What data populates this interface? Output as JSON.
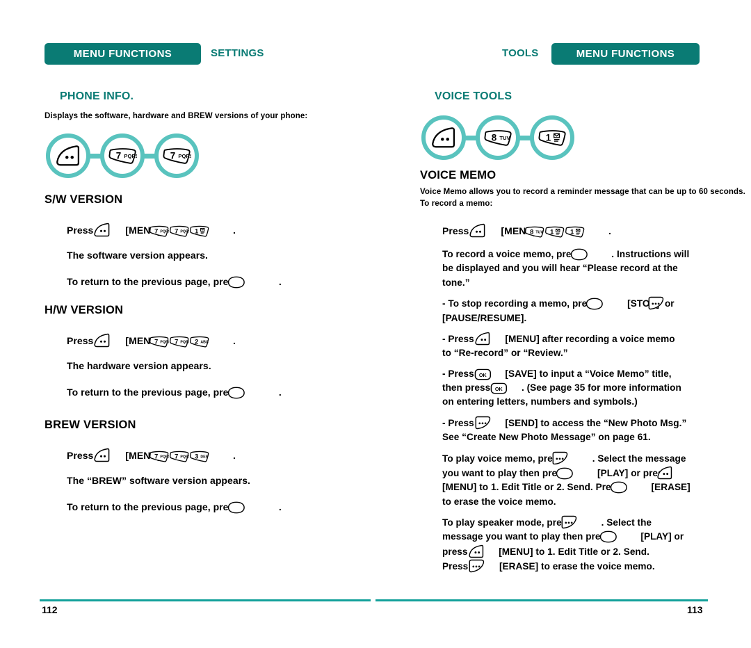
{
  "colors": {
    "band_teal": "#0a7b74",
    "circle_teal": "#59c3be",
    "rule_teal": "#12a09a"
  },
  "left_page": {
    "header": {
      "band_label": "MENU FUNCTIONS",
      "sub_label": "SETTINGS"
    },
    "section_title": "PHONE INFO.",
    "intro": "Displays the software, hardware and BREW versions of your phone:",
    "key_sequence": [
      {
        "icon": "menu-key-icon",
        "label": ""
      },
      {
        "icon": "number-key-icon",
        "digit": "7",
        "letters": "PQRS"
      },
      {
        "icon": "number-key-icon",
        "digit": "7",
        "letters": "PQRS"
      }
    ],
    "blocks": [
      {
        "heading": "S/W VERSION",
        "lines": [
          {
            "text_a": "Press",
            "key_a": "menu-key-icon",
            "text_b": "[MENU]",
            "keys": [
              {
                "digit": "7",
                "letters": "PQRS"
              },
              {
                "digit": "7",
                "letters": "PQRS"
              },
              {
                "digit": "1",
                "letters": "envelope"
              }
            ],
            "text_c": "."
          },
          {
            "text_a": "The software version appears."
          },
          {
            "text_a": "To return to the previous page, press",
            "key_end": "clear-key-icon",
            "text_c": "."
          }
        ]
      },
      {
        "heading": "H/W VERSION",
        "lines": [
          {
            "text_a": "Press",
            "key_a": "menu-key-icon",
            "text_b": "[MENU]",
            "keys": [
              {
                "digit": "7",
                "letters": "PQRS"
              },
              {
                "digit": "7",
                "letters": "PQRS"
              },
              {
                "digit": "2",
                "letters": "ABC"
              }
            ],
            "text_c": "."
          },
          {
            "text_a": "The hardware version appears."
          },
          {
            "text_a": "To return to the previous page, press",
            "key_end": "clear-key-icon",
            "text_c": "."
          }
        ]
      },
      {
        "heading": "BREW VERSION",
        "lines": [
          {
            "text_a": "Press",
            "key_a": "menu-key-icon",
            "text_b": "[MENU]",
            "keys": [
              {
                "digit": "7",
                "letters": "PQRS"
              },
              {
                "digit": "7",
                "letters": "PQRS"
              },
              {
                "digit": "3",
                "letters": "DEF"
              }
            ],
            "text_c": "."
          },
          {
            "text_a": "The “BREW” software version appears."
          },
          {
            "text_a": "To return to the previous page, press",
            "key_end": "clear-key-icon",
            "text_c": "."
          }
        ]
      }
    ],
    "folio": "112"
  },
  "right_page": {
    "header": {
      "band_label": "MENU FUNCTIONS",
      "sub_label": "TOOLS"
    },
    "section_title": "VOICE TOOLS",
    "key_sequence": [
      {
        "icon": "menu-key-icon",
        "label": ""
      },
      {
        "icon": "number-key-icon",
        "digit": "8",
        "letters": "TUV"
      },
      {
        "icon": "number-key-icon",
        "digit": "1",
        "letters": "envelope"
      }
    ],
    "subhead": "VOICE MEMO",
    "intro": "Voice Memo allows you to record a reminder message that can be up to 60 seconds. To record a memo:",
    "press_line": {
      "text_a": "Press",
      "key_a": "menu-key-icon",
      "text_b": "[MENU]",
      "keys": [
        {
          "digit": "8",
          "letters": "TUV"
        },
        {
          "digit": "1",
          "letters": "envelope"
        },
        {
          "digit": "1",
          "letters": "envelope"
        }
      ],
      "text_c": "."
    },
    "paragraphs": [
      {
        "id": "record-paragraph",
        "lines": [
          {
            "segments": [
              {
                "t": "To record a voice memo, press"
              },
              {
                "k": "clear-key-icon",
                "overlap": true
              },
              {
                "gap": "m"
              },
              {
                "t": ". Instructions will"
              }
            ]
          },
          {
            "segments": [
              {
                "t": "be displayed and you will hear “Please record at the"
              }
            ]
          },
          {
            "segments": [
              {
                "t": "tone.”"
              }
            ]
          }
        ]
      },
      {
        "id": "stop-recording-bullet",
        "bullet": true,
        "lines": [
          {
            "segments": [
              {
                "t": "- To stop recording a memo, press"
              },
              {
                "k": "clear-key-icon",
                "overlap": true
              },
              {
                "gap": "m"
              },
              {
                "t": "[STOP]"
              },
              {
                "k": "send-key-icon",
                "overlap": true
              },
              {
                "t": "or"
              }
            ]
          },
          {
            "segments": [
              {
                "t": "[PAUSE/RESUME]."
              }
            ]
          }
        ]
      },
      {
        "id": "menu-after-recording-bullet",
        "bullet": true,
        "lines": [
          {
            "segments": [
              {
                "t": "- Press"
              },
              {
                "k": "menu-key-icon"
              },
              {
                "gap": "s"
              },
              {
                "t": "[MENU] after recording a voice memo"
              }
            ]
          },
          {
            "segments": [
              {
                "t": "to “Re-record” or “Review.”"
              }
            ]
          }
        ]
      },
      {
        "id": "save-bullet",
        "bullet": true,
        "lines": [
          {
            "segments": [
              {
                "t": "- Press"
              },
              {
                "k": "ok-key-icon"
              },
              {
                "gap": "s"
              },
              {
                "t": "[SAVE] to input a “Voice Memo” title,"
              }
            ]
          },
          {
            "segments": [
              {
                "t": "then press"
              },
              {
                "k": "ok-key-icon"
              },
              {
                "gap": "s"
              },
              {
                "t": ". (See page 35 for more information"
              }
            ]
          },
          {
            "segments": [
              {
                "t": "on entering letters, numbers and symbols.)"
              }
            ]
          }
        ]
      },
      {
        "id": "send-bullet",
        "bullet": true,
        "lines": [
          {
            "segments": [
              {
                "t": "- Press"
              },
              {
                "k": "send-key-icon"
              },
              {
                "gap": "s"
              },
              {
                "t": "[SEND] to access the “New Photo Msg.”"
              }
            ]
          },
          {
            "segments": [
              {
                "t": "See “Create New Photo Message” on page 61."
              }
            ]
          }
        ]
      },
      {
        "id": "play-voice-memo-paragraph",
        "lines": [
          {
            "segments": [
              {
                "t": "To play voice memo, press"
              },
              {
                "k": "send-key-icon",
                "overlap": true
              },
              {
                "gap": "m"
              },
              {
                "t": ". Select the message"
              }
            ]
          },
          {
            "segments": [
              {
                "t": "you want to play then press"
              },
              {
                "k": "clear-key-icon",
                "overlap": true
              },
              {
                "gap": "m"
              },
              {
                "t": "[PLAY] or press"
              },
              {
                "k": "menu-key-icon",
                "overlap": true
              }
            ]
          },
          {
            "segments": [
              {
                "t": "[MENU] to 1. Edit Title or 2. Send. Press"
              },
              {
                "k": "clear-key-icon",
                "overlap": true
              },
              {
                "gap": "m"
              },
              {
                "t": "[ERASE]"
              }
            ]
          },
          {
            "segments": [
              {
                "t": "to erase the voice memo."
              }
            ]
          }
        ]
      },
      {
        "id": "speaker-mode-paragraph",
        "lines": [
          {
            "segments": [
              {
                "t": "To play speaker mode, press"
              },
              {
                "k": "send-key-icon",
                "overlap": true
              },
              {
                "gap": "m"
              },
              {
                "t": ". Select the"
              }
            ]
          },
          {
            "segments": [
              {
                "t": "message you want to play then press"
              },
              {
                "k": "clear-key-icon",
                "overlap": true
              },
              {
                "gap": "m"
              },
              {
                "t": "[PLAY] or"
              }
            ]
          },
          {
            "segments": [
              {
                "t": "press"
              },
              {
                "k": "menu-key-icon"
              },
              {
                "gap": "s"
              },
              {
                "t": "[MENU] to 1. Edit Title or 2. Send."
              }
            ]
          },
          {
            "segments": [
              {
                "t": "Press"
              },
              {
                "k": "send-key-icon"
              },
              {
                "gap": "s"
              },
              {
                "t": "[ERASE] to erase the voice memo."
              }
            ]
          }
        ]
      }
    ],
    "folio": "113"
  }
}
